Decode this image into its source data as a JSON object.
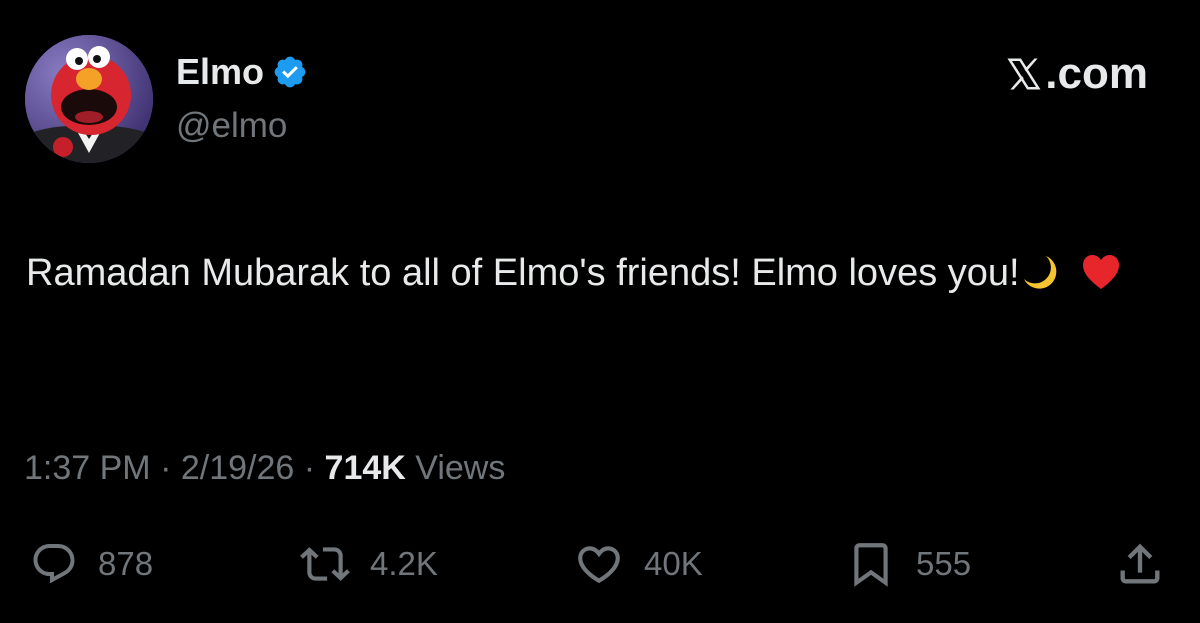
{
  "user": {
    "display_name": "Elmo",
    "handle": "@elmo",
    "verified": true,
    "verified_color": "#1d9bf0"
  },
  "brand": {
    "label": ".com",
    "icon": "x-logo-icon"
  },
  "tweet": {
    "text": "Ramadan Mubarak to all of Elmo's friends! Elmo loves you!",
    "emojis": [
      "crescent-moon-icon",
      "red-heart-icon"
    ]
  },
  "meta": {
    "time": "1:37 PM",
    "separator": "·",
    "date": "2/19/26",
    "views_count": "714K",
    "views_label": "Views"
  },
  "actions": {
    "replies": "878",
    "reposts": "4.2K",
    "likes": "40K",
    "bookmarks": "555",
    "icons": [
      "reply-icon",
      "repost-icon",
      "like-icon",
      "bookmark-icon",
      "share-icon"
    ]
  },
  "colors": {
    "background": "#000000",
    "primary_text": "#e7e9ea",
    "secondary_text": "#71767b"
  }
}
